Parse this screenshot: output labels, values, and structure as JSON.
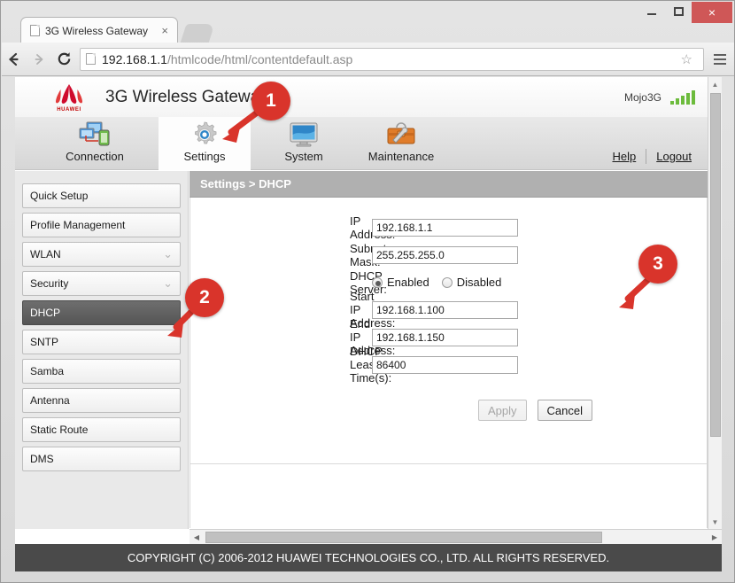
{
  "browser": {
    "window_controls": {
      "minimize": "minimize-button",
      "maximize": "maximize-button",
      "close": "×"
    },
    "tab": {
      "title": "3G Wireless Gateway",
      "close_label": "×"
    },
    "nav": {
      "back": "←",
      "forward": "→",
      "reload": "↻",
      "bookmark": "☆"
    },
    "address": {
      "host": "192.168.1.1",
      "path": "/htmlcode/html/contentdefault.asp",
      "full": "192.168.1.1/htmlcode/html/contentdefault.asp"
    }
  },
  "page": {
    "brand": {
      "logo_text": "HUAWEI",
      "app_title": "3G Wireless Gateway",
      "operator": "Mojo3G",
      "signal_bars": 5
    },
    "nav_tabs": [
      {
        "label": "Connection",
        "icon": "network-computers-icon",
        "active": false
      },
      {
        "label": "Settings",
        "icon": "gear-icon",
        "active": true
      },
      {
        "label": "System",
        "icon": "monitor-icon",
        "active": false
      },
      {
        "label": "Maintenance",
        "icon": "toolbox-wrench-icon",
        "active": false
      }
    ],
    "nav_links": [
      {
        "label": "Help"
      },
      {
        "label": "Logout"
      }
    ],
    "sidebar": [
      {
        "label": "Quick Setup",
        "expandable": false,
        "selected": false
      },
      {
        "label": "Profile Management",
        "expandable": false,
        "selected": false
      },
      {
        "label": "WLAN",
        "expandable": true,
        "selected": false
      },
      {
        "label": "Security",
        "expandable": true,
        "selected": false
      },
      {
        "label": "DHCP",
        "expandable": false,
        "selected": true
      },
      {
        "label": "SNTP",
        "expandable": false,
        "selected": false
      },
      {
        "label": "Samba",
        "expandable": false,
        "selected": false
      },
      {
        "label": "Antenna",
        "expandable": false,
        "selected": false
      },
      {
        "label": "Static Route",
        "expandable": false,
        "selected": false
      },
      {
        "label": "DMS",
        "expandable": false,
        "selected": false
      }
    ],
    "breadcrumb": "Settings > DHCP",
    "form": {
      "fields": [
        {
          "label": "IP Address:",
          "value": "192.168.1.1",
          "type": "text"
        },
        {
          "label": "Subnet Mask:",
          "value": "255.255.255.0",
          "type": "text"
        },
        {
          "label": "Start IP Address:",
          "value": "192.168.1.100",
          "type": "text"
        },
        {
          "label": "End IP Address:",
          "value": "192.168.1.150",
          "type": "text"
        },
        {
          "label": "DHCP Lease Time(s):",
          "value": "86400",
          "type": "text"
        }
      ],
      "dhcp_server": {
        "label": "DHCP Server:",
        "options": [
          {
            "label": "Enabled",
            "selected": true
          },
          {
            "label": "Disabled",
            "selected": false
          }
        ]
      },
      "buttons": [
        {
          "label": "Apply",
          "disabled": true
        },
        {
          "label": "Cancel",
          "disabled": false
        }
      ]
    },
    "footer": "COPYRIGHT (C) 2006-2012 HUAWEI TECHNOLOGIES CO., LTD. ALL RIGHTS RESERVED.",
    "chevron_glyph": "⌄"
  },
  "annotations": {
    "markers": [
      {
        "number": "1",
        "target": "settings-tab"
      },
      {
        "number": "2",
        "target": "dhcp-sidebar-item"
      },
      {
        "number": "3",
        "target": "disabled-radio"
      }
    ]
  },
  "colors": {
    "marker_red": "#d9342b",
    "arrow_red": "#d9342b",
    "selected_item": "#5d5d5d",
    "breadcrumb_bg": "#b0b0b0",
    "footer_bg": "#4a4a4a",
    "signal_green": "#6cbb3c",
    "huawei_red": "#c00000"
  }
}
